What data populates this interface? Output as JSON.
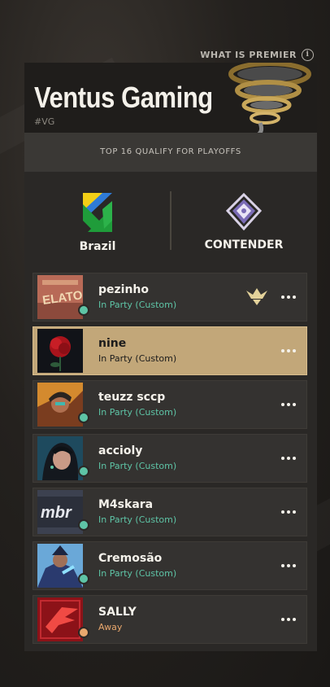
{
  "premier_link": {
    "label": "WHAT IS PREMIER",
    "icon": "info-icon"
  },
  "team": {
    "name": "Ventus Gaming",
    "tag": "#VG",
    "logo": "tornado-logo"
  },
  "qualify_text": "TOP 16 QUALIFY FOR PLAYOFFS",
  "region": {
    "label": "Brazil",
    "icon": "brazil-flag-icon"
  },
  "division": {
    "label": "CONTENDER",
    "icon": "contender-rank-icon"
  },
  "colors": {
    "accent_gold": "#c2a779",
    "online": "#5ec4a6",
    "away": "#e8a76d"
  },
  "members": [
    {
      "name": "pezinho",
      "status": "In Party (Custom)",
      "state": "online",
      "leader": true,
      "avatar": "gelato-avatar"
    },
    {
      "name": "nine",
      "status": "In Party (Custom)",
      "state": "online",
      "active": true,
      "avatar": "rose-avatar"
    },
    {
      "name": "teuzz sccp",
      "status": "In Party (Custom)",
      "state": "online",
      "avatar": "agent-portrait-avatar"
    },
    {
      "name": "accioly",
      "status": "In Party (Custom)",
      "state": "online",
      "avatar": "agent-portrait-avatar"
    },
    {
      "name": "M4skara",
      "status": "In Party (Custom)",
      "state": "online",
      "avatar": "mbr-logo-avatar"
    },
    {
      "name": "Cremosão",
      "status": "In Party (Custom)",
      "state": "online",
      "avatar": "agent-portrait-avatar"
    },
    {
      "name": "SALLY",
      "status": "Away",
      "state": "away",
      "avatar": "red-bird-avatar"
    }
  ]
}
